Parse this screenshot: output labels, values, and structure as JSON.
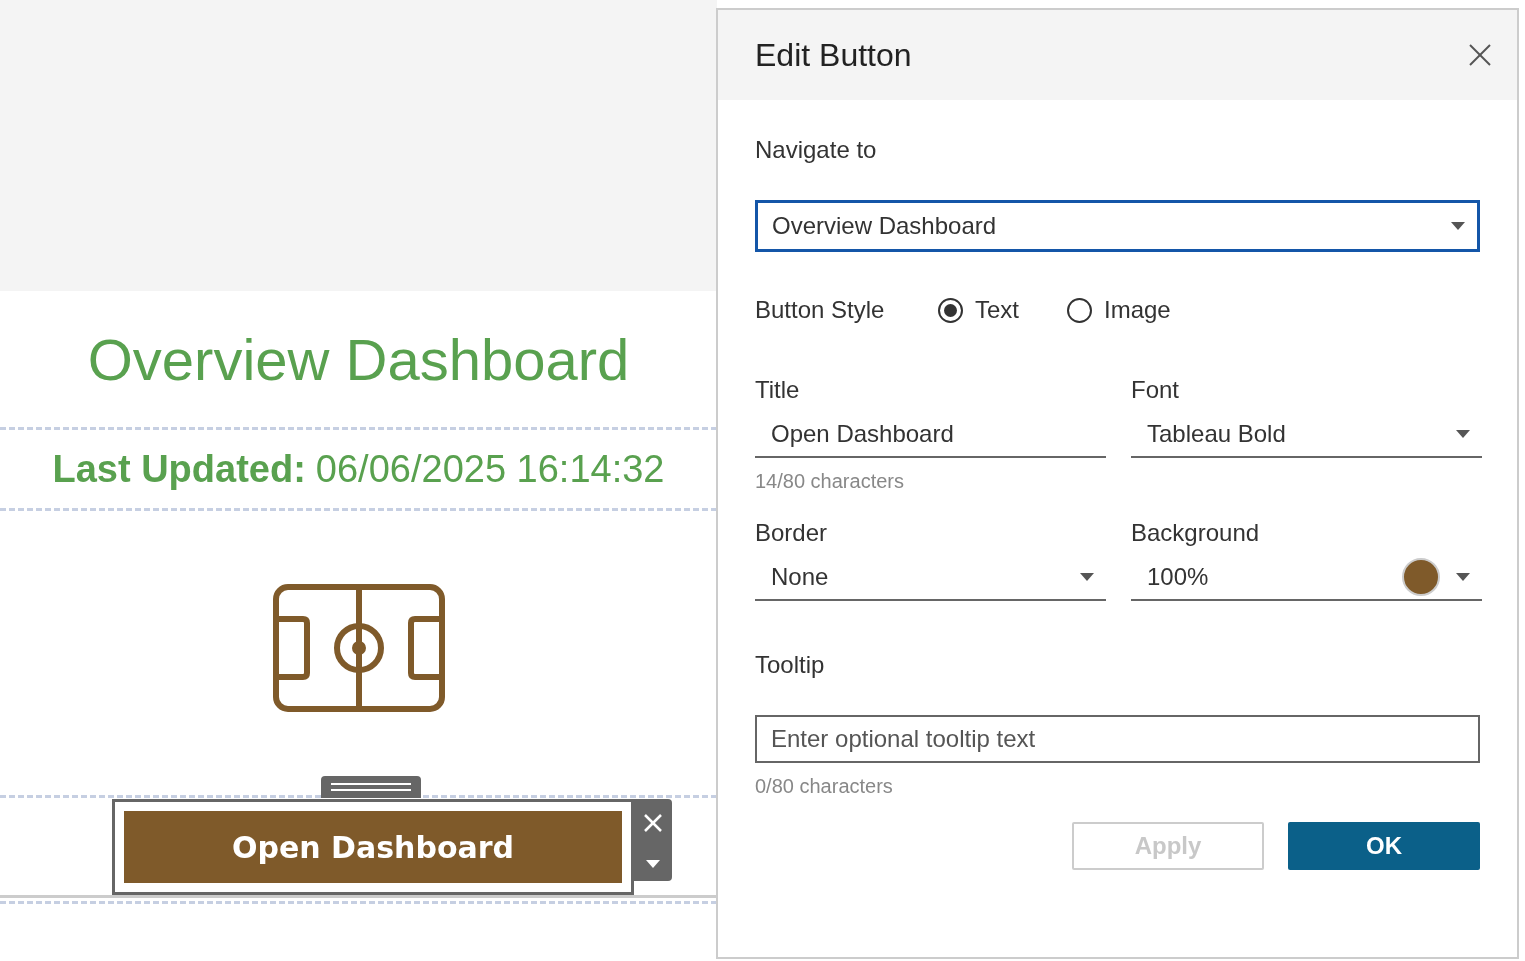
{
  "dashboard": {
    "title": "Overview Dashboard",
    "last_updated_label": "Last Updated:",
    "last_updated_value": "06/06/2025 16:14:32",
    "button": {
      "label": "Open Dashboard",
      "selected": true
    }
  },
  "dialog": {
    "title": "Edit Button",
    "navigate_label": "Navigate to",
    "navigate_value": "Overview Dashboard",
    "style_label": "Button Style",
    "style_options": [
      {
        "label": "Text",
        "selected": true
      },
      {
        "label": "Image",
        "selected": false
      }
    ],
    "title_label": "Title",
    "title_value": "Open Dashboard",
    "title_count": "14/80 characters",
    "font_label": "Font",
    "font_value": "Tableau Bold",
    "border_label": "Border",
    "border_value": "None",
    "background_label": "Background",
    "background_value": "100%",
    "color": "#7f5a2a",
    "tooltip_label": "Tooltip",
    "tooltip_placeholder": "Enter optional tooltip text",
    "tooltip_count": "0/80 characters",
    "buttons": [
      {
        "label": "Apply",
        "disabled": true
      },
      {
        "label": "OK",
        "disabled": false
      }
    ]
  }
}
